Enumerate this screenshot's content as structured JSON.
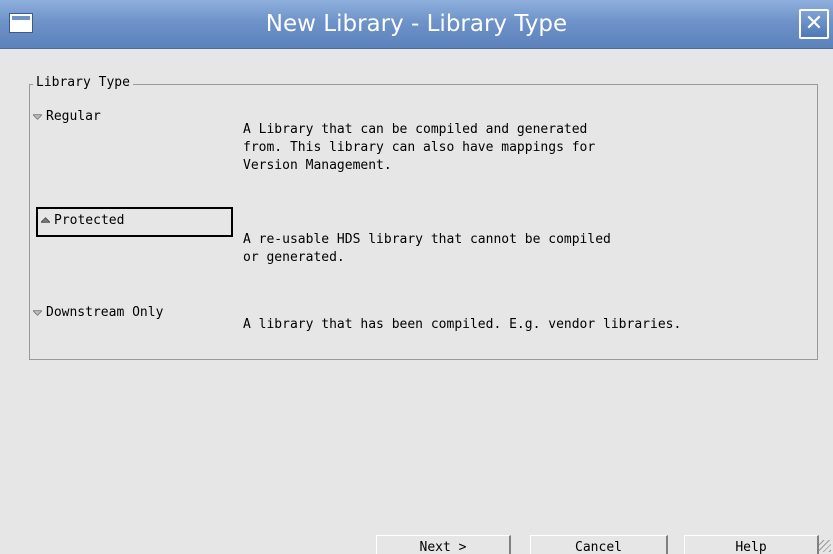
{
  "window": {
    "title": "New Library - Library Type",
    "close_label": "✕"
  },
  "group": {
    "legend": "Library Type",
    "options": [
      {
        "label": "Regular",
        "description": "A Library that can be compiled and generated\nfrom. This library can also have mappings for\nVersion Management.",
        "selected": false
      },
      {
        "label": "Protected",
        "description": "A re-usable HDS library that cannot be compiled\nor generated.",
        "selected": true
      },
      {
        "label": "Downstream Only",
        "description": "A library that has been compiled. E.g. vendor libraries.",
        "selected": false
      }
    ]
  },
  "buttons": {
    "next": "Next >",
    "cancel": "Cancel",
    "help": "Help"
  }
}
